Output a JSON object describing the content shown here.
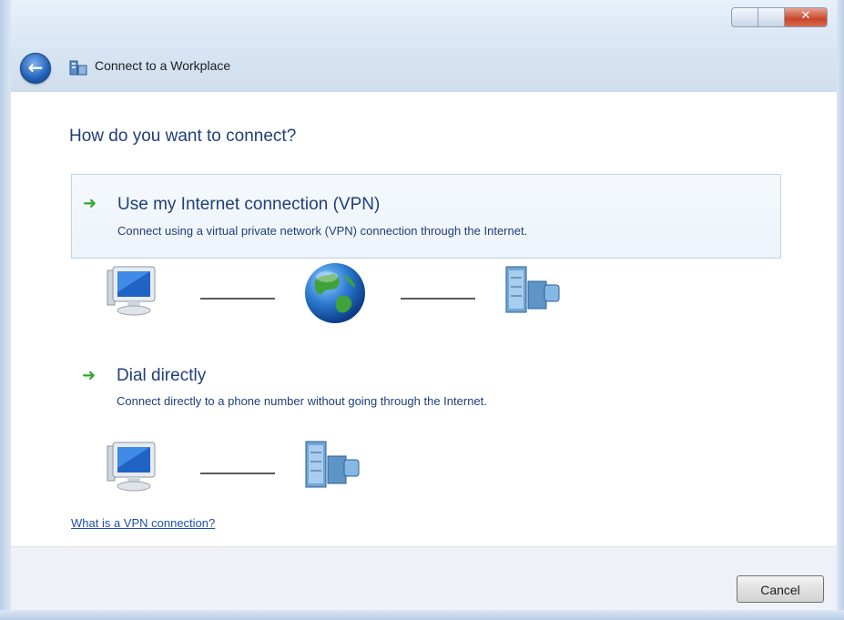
{
  "window": {
    "title": "Connect to a Workplace"
  },
  "page": {
    "heading": "How do you want to connect?"
  },
  "options": [
    {
      "title": "Use my Internet connection (VPN)",
      "description": "Connect using a virtual private network (VPN) connection through the Internet."
    },
    {
      "title": "Dial directly",
      "description": "Connect directly to a phone number without going through the Internet."
    }
  ],
  "links": {
    "vpn_help": "What is a VPN connection?"
  },
  "buttons": {
    "cancel": "Cancel"
  },
  "icons": {
    "back": "back-arrow-icon",
    "title": "workplace-icon",
    "option_arrow": "green-arrow-icon",
    "computer": "computer-icon",
    "globe": "internet-globe-icon",
    "server": "workplace-server-icon"
  },
  "colors": {
    "accent_text": "#1f3f7a",
    "link": "#1d4fb0",
    "arrow": "#2fa72f",
    "option_hover_bg": "#f0f5fb"
  }
}
